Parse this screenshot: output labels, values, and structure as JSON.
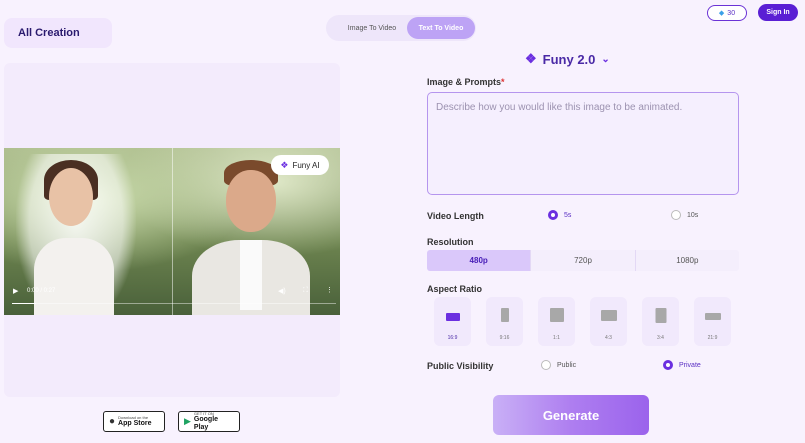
{
  "sidebar": {
    "title": "All Creation"
  },
  "tabs": [
    {
      "label": "Image To Video"
    },
    {
      "label": "Text To Video"
    }
  ],
  "header": {
    "credits": "30",
    "signin": "Sign In"
  },
  "preview": {
    "badge": "Funy AI",
    "time": "0:00 / 0:27"
  },
  "stores": [
    {
      "small": "Download on the",
      "big": "App Store"
    },
    {
      "small": "GET IT ON",
      "big": "Google Play"
    }
  ],
  "form": {
    "model": "Funy 2.0",
    "prompt_label": "Image & Prompts",
    "prompt_required": "*",
    "prompt_placeholder": "Describe how you would like this image to be animated.",
    "length_label": "Video Length",
    "lengths": [
      "5s",
      "10s"
    ],
    "length_selected": "5s",
    "resolution_label": "Resolution",
    "resolutions": [
      "480p",
      "720p",
      "1080p"
    ],
    "resolution_selected": "480p",
    "aspect_label": "Aspect Ratio",
    "aspects": [
      "16:9",
      "9:16",
      "1:1",
      "4:3",
      "3:4",
      "21:9"
    ],
    "aspect_selected": "16:9",
    "visibility_label": "Public Visibility",
    "visibility": [
      "Public",
      "Private"
    ],
    "visibility_selected": "Private",
    "generate": "Generate"
  },
  "colors": {
    "accent": "#6b2fe0",
    "background": "#f8f2fe"
  }
}
